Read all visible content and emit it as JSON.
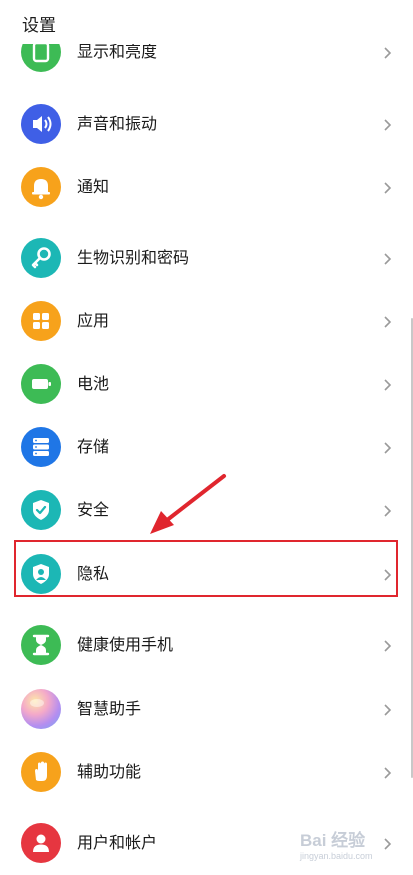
{
  "header": {
    "title": "设置"
  },
  "rows": [
    {
      "label": "显示和亮度",
      "icon": "display-icon",
      "color": "#3dbb55"
    },
    {
      "label": "声音和振动",
      "icon": "speaker-icon",
      "color": "#3f5fe6"
    },
    {
      "label": "通知",
      "icon": "bell-icon",
      "color": "#f7a21b"
    },
    {
      "label": "生物识别和密码",
      "icon": "key-icon",
      "color": "#1cb7b5"
    },
    {
      "label": "应用",
      "icon": "apps-grid-icon",
      "color": "#f7a21b"
    },
    {
      "label": "电池",
      "icon": "battery-icon",
      "color": "#3dbb55"
    },
    {
      "label": "存储",
      "icon": "storage-icon",
      "color": "#1f76e6"
    },
    {
      "label": "安全",
      "icon": "shield-check-icon",
      "color": "#1cb7b5"
    },
    {
      "label": "隐私",
      "icon": "privacy-shield-icon",
      "color": "#1cb7b5"
    },
    {
      "label": "健康使用手机",
      "icon": "hourglass-icon",
      "color": "#3dbb55"
    },
    {
      "label": "智慧助手",
      "icon": "assistant-orb-icon",
      "color": "#e19ad9"
    },
    {
      "label": "辅助功能",
      "icon": "hand-icon",
      "color": "#f7a21b"
    },
    {
      "label": "用户和帐户",
      "icon": "user-icon",
      "color": "#e63640"
    }
  ],
  "highlight_color": "#e0262e",
  "watermark": {
    "brand": "Bai 经验",
    "url": "jingyan.baidu.com"
  }
}
